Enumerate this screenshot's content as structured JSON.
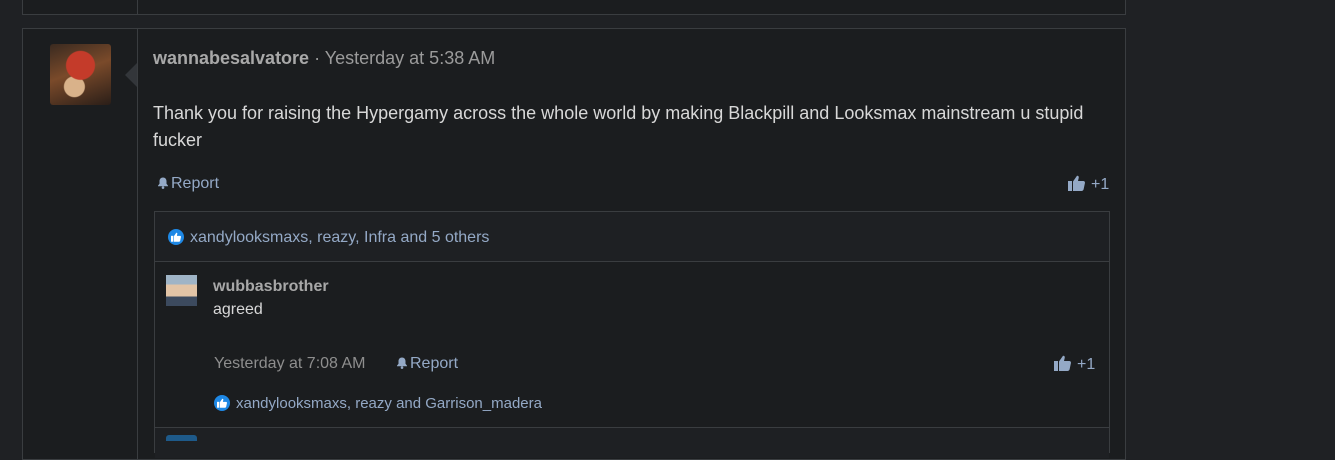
{
  "post": {
    "username": "wannabesalvatore",
    "separator": "·",
    "timestamp": "Yesterday at 5:38 AM",
    "body": "Thank you for raising the Hypergamy across the whole world by making Blackpill and Looksmax mainstream u stupid fucker",
    "report_label": "Report",
    "like_label": "+1",
    "likes_summary": "xandylooksmaxs, reazy, Infra and 5 others"
  },
  "reply": {
    "username": "wubbasbrother",
    "text": "agreed",
    "timestamp": "Yesterday at 7:08 AM",
    "report_label": "Report",
    "like_label": "+1",
    "likes_summary": "xandylooksmaxs, reazy and Garrison_madera"
  },
  "colors": {
    "background": "#1f2124",
    "panel": "#1b1d1f",
    "border": "#3a3d40",
    "link": "#94a9c6",
    "like_badge": "#1e88e5"
  }
}
